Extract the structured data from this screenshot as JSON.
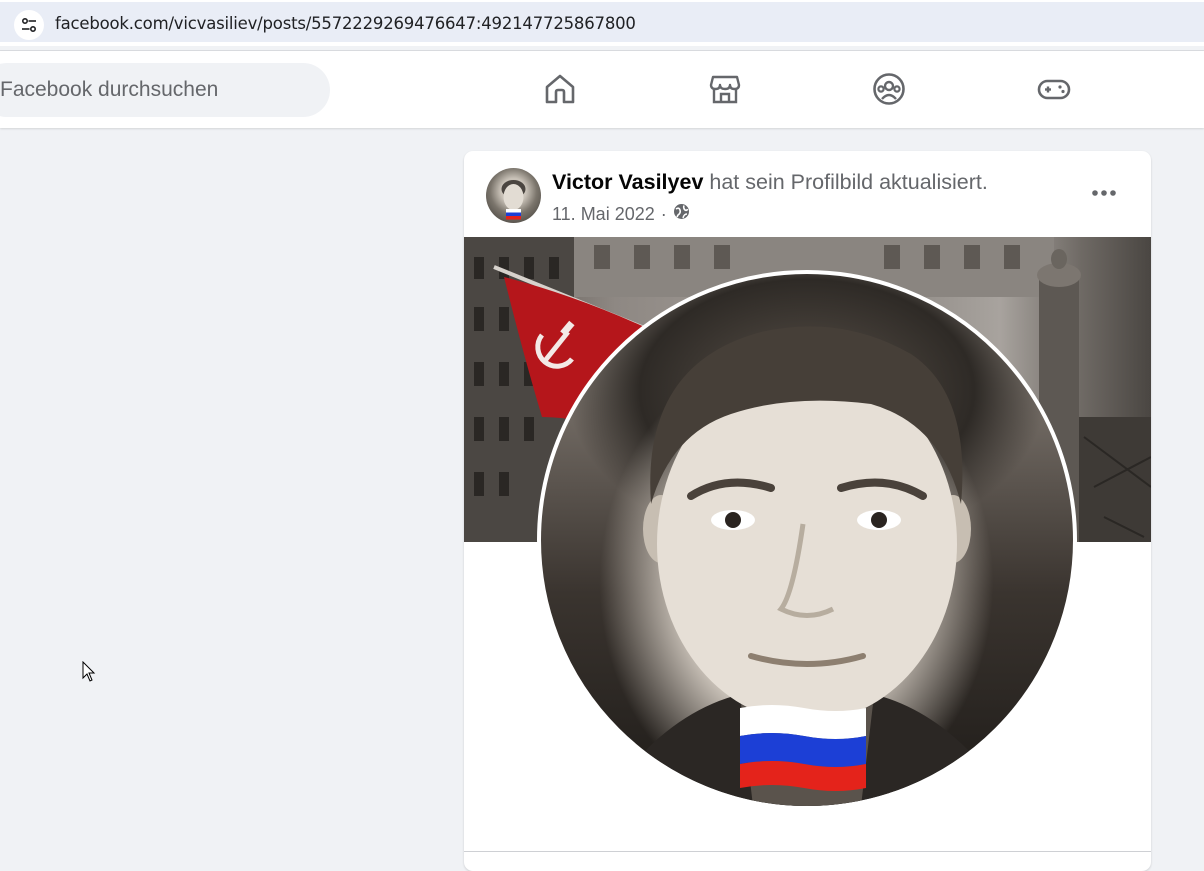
{
  "browser": {
    "url": "facebook.com/vicvasiliev/posts/5572229269476647:492147725867800",
    "site_settings_icon": "tune-icon"
  },
  "header": {
    "search_placeholder": "Facebook durchsuchen",
    "nav": [
      "home-icon",
      "marketplace-icon",
      "groups-icon",
      "gaming-icon"
    ]
  },
  "post": {
    "author": "Victor Vasilyev",
    "action": "hat sein Profilbild aktualisiert.",
    "date": "11. Mai 2022",
    "separator": "·",
    "privacy_icon": "globe-icon",
    "menu_icon": "more-horizontal-icon"
  },
  "colors": {
    "background": "#f0f2f5",
    "card": "#ffffff",
    "text_primary": "#050505",
    "text_secondary": "#65676b",
    "flag_white": "#ffffff",
    "flag_blue": "#1c3fd6",
    "flag_red": "#e4231b",
    "soviet_red": "#b5161b"
  }
}
